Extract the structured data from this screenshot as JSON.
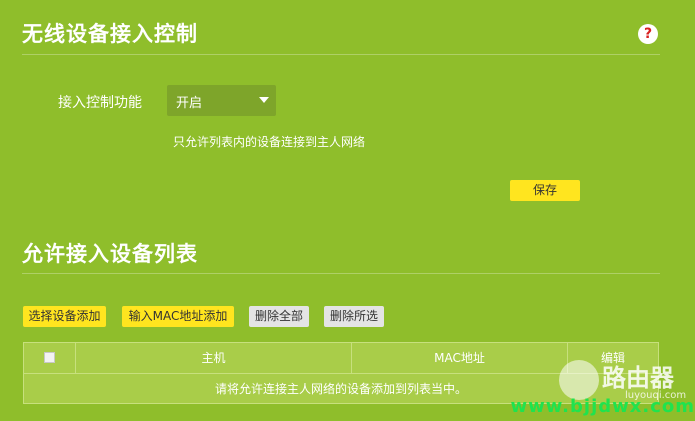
{
  "section1": {
    "title": "无线设备接入控制",
    "help_icon": "?",
    "field_label": "接入控制功能",
    "select_value": "开启",
    "description": "只允许列表内的设备连接到主人网络",
    "save_label": "保存"
  },
  "section2": {
    "title": "允许接入设备列表",
    "buttons": {
      "select_add": "选择设备添加",
      "mac_add": "输入MAC地址添加",
      "delete_all": "删除全部",
      "delete_selected": "删除所选"
    },
    "table": {
      "columns": [
        "主机",
        "MAC地址",
        "编辑"
      ],
      "empty_text": "请将允许连接主人网络的设备添加到列表当中。"
    }
  },
  "watermark": {
    "cn": "路由器",
    "pinyin": "luyouqi.com",
    "url": "www.bjjdwx.com"
  },
  "colors": {
    "background": "#8fbe2b",
    "accent_button": "#ffe51f",
    "table_bg": "#a9cd49",
    "help_icon": "#d92020"
  }
}
